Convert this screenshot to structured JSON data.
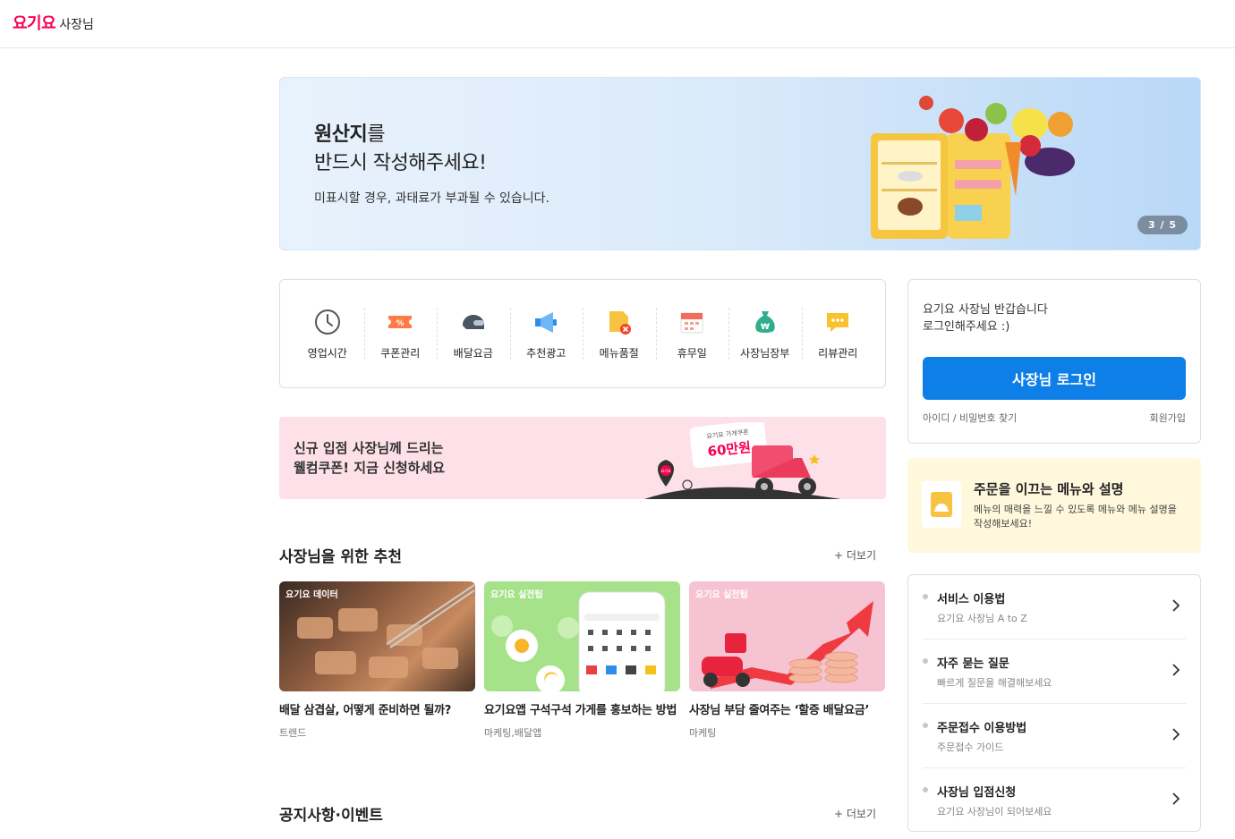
{
  "header": {
    "brand": "요기요",
    "subtitle": "사장님"
  },
  "hero": {
    "title_bold": "원산지",
    "title_rest": "를",
    "title_line2": "반드시 작성해주세요!",
    "desc": "미표시할 경우, 과태료가 부과될 수 있습니다.",
    "pager": "3 / 5"
  },
  "quick_menu": [
    {
      "label": "영업시간",
      "icon": "clock-icon"
    },
    {
      "label": "쿠폰관리",
      "icon": "coupon-icon"
    },
    {
      "label": "배달요금",
      "icon": "helmet-icon"
    },
    {
      "label": "추천광고",
      "icon": "megaphone-icon"
    },
    {
      "label": "메뉴품절",
      "icon": "sold-out-icon"
    },
    {
      "label": "휴무일",
      "icon": "calendar-icon"
    },
    {
      "label": "사장님장부",
      "icon": "money-bag-icon"
    },
    {
      "label": "리뷰관리",
      "icon": "review-bubble-icon"
    }
  ],
  "promo": {
    "line1": "신규 입점 사장님께 드리는",
    "line2": "웰컴쿠폰! 지금 신청하세요",
    "coupon_label": "요기요 가게쿠폰",
    "coupon_amount": "60만원",
    "pin_label": "요기요"
  },
  "recommend": {
    "title": "사장님을 위한 추천",
    "more": "더보기",
    "cards": [
      {
        "tag": "요기요 데이터",
        "title": "배달 삼겹살, 어떻게 준비하면 될까?",
        "category": "트렌드"
      },
      {
        "tag": "요기요 실전팁",
        "title": "요기요앱 구석구석 가게를 홍보하는 방법",
        "category": "마케팅,배달앱"
      },
      {
        "tag": "요기요 실전팁",
        "title": "사장님 부담 줄여주는 ‘할증 배달요금’",
        "category": "마케팅"
      }
    ]
  },
  "notice": {
    "title": "공지사항·이벤트",
    "more": "더보기"
  },
  "login": {
    "greeting_line1": "요기요 사장님 반갑습니다",
    "greeting_line2": "로그인해주세요 :)",
    "button": "사장님 로그인",
    "find": "아이디 / 비밀번호 찾기",
    "join": "회원가입"
  },
  "tip": {
    "title": "주문을 이끄는 메뉴와 설명",
    "desc": "메뉴의 매력을 느낄 수 있도록 메뉴와 메뉴 설명을 작성해보세요!"
  },
  "links": [
    {
      "title": "서비스 이용법",
      "sub": "요기요 사장님 A to Z"
    },
    {
      "title": "자주 묻는 질문",
      "sub": "빠르게 질문을 해결해보세요"
    },
    {
      "title": "주문접수 이용방법",
      "sub": "주문접수 가이드"
    },
    {
      "title": "사장님 입점신청",
      "sub": "요기요 사장님이 되어보세요"
    }
  ],
  "colors": {
    "brand": "#fa0050",
    "primary_button": "#0f7fe8",
    "promo_bg": "#fde0e8",
    "tip_bg": "#fff8dc"
  }
}
